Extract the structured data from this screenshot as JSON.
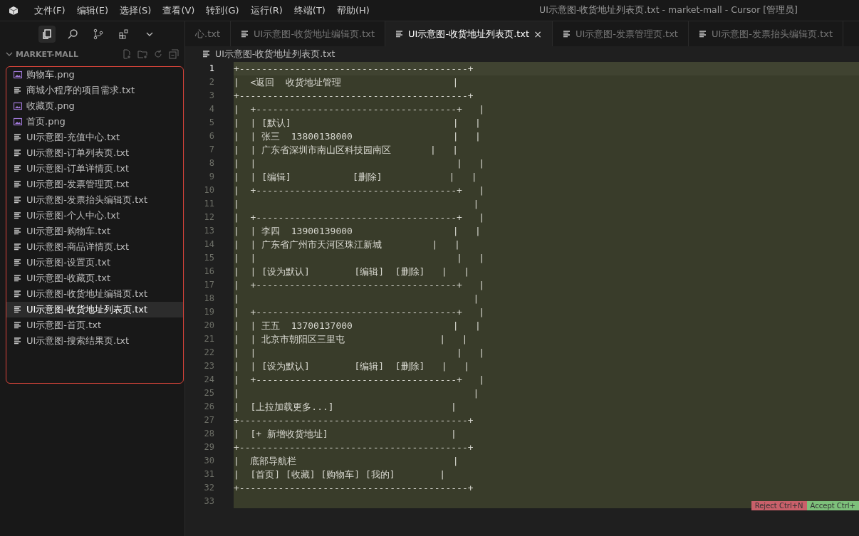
{
  "menu": [
    "文件(F)",
    "编辑(E)",
    "选择(S)",
    "查看(V)",
    "转到(G)",
    "运行(R)",
    "终端(T)",
    "帮助(H)"
  ],
  "window": {
    "title": "UI示意图-收货地址列表页.txt - market-mall - Cursor [管理员]"
  },
  "sidebar": {
    "title": "MARKET-MALL",
    "files": [
      {
        "name": "购物车.png",
        "kind": "image",
        "selected": false
      },
      {
        "name": "商城小程序的项目需求.txt",
        "kind": "text",
        "selected": false
      },
      {
        "name": "收藏页.png",
        "kind": "image",
        "selected": false
      },
      {
        "name": "首页.png",
        "kind": "image",
        "selected": false
      },
      {
        "name": "UI示意图-充值中心.txt",
        "kind": "text",
        "selected": false
      },
      {
        "name": "UI示意图-订单列表页.txt",
        "kind": "text",
        "selected": false
      },
      {
        "name": "UI示意图-订单详情页.txt",
        "kind": "text",
        "selected": false
      },
      {
        "name": "UI示意图-发票管理页.txt",
        "kind": "text",
        "selected": false
      },
      {
        "name": "UI示意图-发票抬头编辑页.txt",
        "kind": "text",
        "selected": false
      },
      {
        "name": "UI示意图-个人中心.txt",
        "kind": "text",
        "selected": false
      },
      {
        "name": "UI示意图-购物车.txt",
        "kind": "text",
        "selected": false
      },
      {
        "name": "UI示意图-商品详情页.txt",
        "kind": "text",
        "selected": false
      },
      {
        "name": "UI示意图-设置页.txt",
        "kind": "text",
        "selected": false
      },
      {
        "name": "UI示意图-收藏页.txt",
        "kind": "text",
        "selected": false
      },
      {
        "name": "UI示意图-收货地址编辑页.txt",
        "kind": "text",
        "selected": false
      },
      {
        "name": "UI示意图-收货地址列表页.txt",
        "kind": "text",
        "selected": true
      },
      {
        "name": "UI示意图-首页.txt",
        "kind": "text",
        "selected": false
      },
      {
        "name": "UI示意图-搜索结果页.txt",
        "kind": "text",
        "selected": false
      }
    ]
  },
  "tabs": [
    {
      "label": "心.txt",
      "selected": false,
      "icon": false
    },
    {
      "label": "UI示意图-收货地址编辑页.txt",
      "selected": false,
      "icon": true
    },
    {
      "label": "UI示意图-收货地址列表页.txt",
      "selected": true,
      "icon": true,
      "close": "×"
    },
    {
      "label": "UI示意图-发票管理页.txt",
      "selected": false,
      "icon": true
    },
    {
      "label": "UI示意图-发票抬头编辑页.txt",
      "selected": false,
      "icon": true
    }
  ],
  "breadcrumb": "UI示意图-收货地址列表页.txt",
  "editor": {
    "lines": [
      {
        "number": "1",
        "text": "+-----------------------------------------+",
        "selected": true
      },
      {
        "number": "2",
        "text": "|  <返回  收货地址管理                    |",
        "selected": false
      },
      {
        "number": "3",
        "text": "+-----------------------------------------+",
        "selected": false
      },
      {
        "number": "4",
        "text": "|  +------------------------------------+   |",
        "selected": false
      },
      {
        "number": "5",
        "text": "|  | [默认]                             |   |",
        "selected": false
      },
      {
        "number": "6",
        "text": "|  | 张三  13800138000                  |   |",
        "selected": false
      },
      {
        "number": "7",
        "text": "|  | 广东省深圳市南山区科技园南区       |   |",
        "selected": false
      },
      {
        "number": "8",
        "text": "|  |                                    |   |",
        "selected": false
      },
      {
        "number": "9",
        "text": "|  | [编辑]           [删除]            |   |",
        "selected": false
      },
      {
        "number": "10",
        "text": "|  +------------------------------------+   |",
        "selected": false
      },
      {
        "number": "11",
        "text": "|                                          |",
        "selected": false
      },
      {
        "number": "12",
        "text": "|  +------------------------------------+   |",
        "selected": false
      },
      {
        "number": "13",
        "text": "|  | 李四  13900139000                  |   |",
        "selected": false
      },
      {
        "number": "14",
        "text": "|  | 广东省广州市天河区珠江新城         |   |",
        "selected": false
      },
      {
        "number": "15",
        "text": "|  |                                    |   |",
        "selected": false
      },
      {
        "number": "16",
        "text": "|  | [设为默认]        [编辑]  [删除]   |   |",
        "selected": false
      },
      {
        "number": "17",
        "text": "|  +------------------------------------+   |",
        "selected": false
      },
      {
        "number": "18",
        "text": "|                                          |",
        "selected": false
      },
      {
        "number": "19",
        "text": "|  +------------------------------------+   |",
        "selected": false
      },
      {
        "number": "20",
        "text": "|  | 王五  13700137000                  |   |",
        "selected": false
      },
      {
        "number": "21",
        "text": "|  | 北京市朝阳区三里屯                 |   |",
        "selected": false
      },
      {
        "number": "22",
        "text": "|  |                                    |   |",
        "selected": false
      },
      {
        "number": "23",
        "text": "|  | [设为默认]        [编辑]  [删除]   |   |",
        "selected": false
      },
      {
        "number": "24",
        "text": "|  +------------------------------------+   |",
        "selected": false
      },
      {
        "number": "25",
        "text": "|                                          |",
        "selected": false
      },
      {
        "number": "26",
        "text": "|  [上拉加载更多...]                     |",
        "selected": false
      },
      {
        "number": "27",
        "text": "+-----------------------------------------+",
        "selected": false
      },
      {
        "number": "28",
        "text": "|  [+ 新增收货地址]                      |",
        "selected": false
      },
      {
        "number": "29",
        "text": "+-----------------------------------------+",
        "selected": false
      },
      {
        "number": "30",
        "text": "|  底部导航栏                            |",
        "selected": false
      },
      {
        "number": "31",
        "text": "|  [首页] [收藏] [购物车] [我的]        |",
        "selected": false
      },
      {
        "number": "32",
        "text": "+-----------------------------------------+",
        "selected": false
      },
      {
        "number": "33",
        "selected": false
      }
    ]
  },
  "diff_actions": [
    "Reject Ctrl+N",
    "Accept Ctrl+"
  ]
}
